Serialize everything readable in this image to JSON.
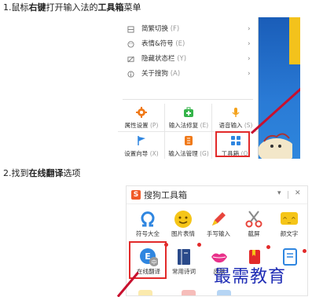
{
  "steps": {
    "one": {
      "prefix": "1.鼠标",
      "bold1": "右键",
      "middle": "打开输入法的",
      "bold2": "工具箱",
      "suffix": "菜单"
    },
    "two": {
      "prefix": "2.找到",
      "bold1": "在线翻译",
      "suffix": "选项"
    }
  },
  "context_menu": {
    "items": [
      {
        "label": "简繁切换",
        "key": "(F)",
        "icon": "simplified-traditional-icon",
        "has_submenu": true
      },
      {
        "label": "表情&符号",
        "key": "(E)",
        "icon": "emoji-icon",
        "has_submenu": true
      },
      {
        "label": "隐藏状态栏",
        "key": "(Y)",
        "icon": "hide-statusbar-icon",
        "has_submenu": true
      },
      {
        "label": "关于搜狗",
        "key": "(A)",
        "icon": "about-icon",
        "has_submenu": true
      }
    ],
    "tiles": [
      {
        "label": "属性设置",
        "key": "(P)",
        "icon": "gear-icon",
        "color": "#f07a1a"
      },
      {
        "label": "输入法修复",
        "key": "(E)",
        "icon": "repair-kit-icon",
        "color": "#35b44a"
      },
      {
        "label": "语音输入",
        "key": "(S)",
        "icon": "microphone-icon",
        "color": "#f4a21b"
      },
      {
        "label": "设置向导",
        "key": "(X)",
        "icon": "flag-icon",
        "color": "#2f86e0"
      },
      {
        "label": "输入法管理",
        "key": "(G)",
        "icon": "manage-icon",
        "color": "#f07a1a"
      },
      {
        "label": "工具箱",
        "key": "(O)",
        "icon": "toolbox-grid-icon",
        "color": "#2f86e0"
      }
    ]
  },
  "toolbox": {
    "title": "搜狗工具箱",
    "logo": "S",
    "buttons": {
      "menu": "▾",
      "close": "✕"
    },
    "row1": [
      {
        "label": "符号大全",
        "icon": "omega-icon",
        "color": "#2f86e0"
      },
      {
        "label": "图片表情",
        "icon": "smiley-icon",
        "color": "#f5c518"
      },
      {
        "label": "手写输入",
        "icon": "pen-icon",
        "color": "#e8453c"
      },
      {
        "label": "截屏",
        "icon": "scissors-icon",
        "color": "#e8453c"
      },
      {
        "label": "颜文字",
        "icon": "kaomoji-icon",
        "color": "#f5c518",
        "text": "^_^"
      }
    ],
    "row2": [
      {
        "label": "在线翻译",
        "icon": "translate-icon",
        "color": "#2f86e0",
        "badge": "中"
      },
      {
        "label": "常用诗词",
        "icon": "book-icon",
        "color": "#2a4a8a"
      },
      {
        "label": "皮肤",
        "icon": "lips-icon",
        "color": "#e8318a"
      },
      {
        "label": "",
        "icon": "bookmark-icon",
        "color": "#e22a2a"
      },
      {
        "label": "",
        "icon": "document-icon",
        "color": "#2f86e0"
      }
    ]
  },
  "watermark": "最需教育",
  "accent": "#e22a2a"
}
